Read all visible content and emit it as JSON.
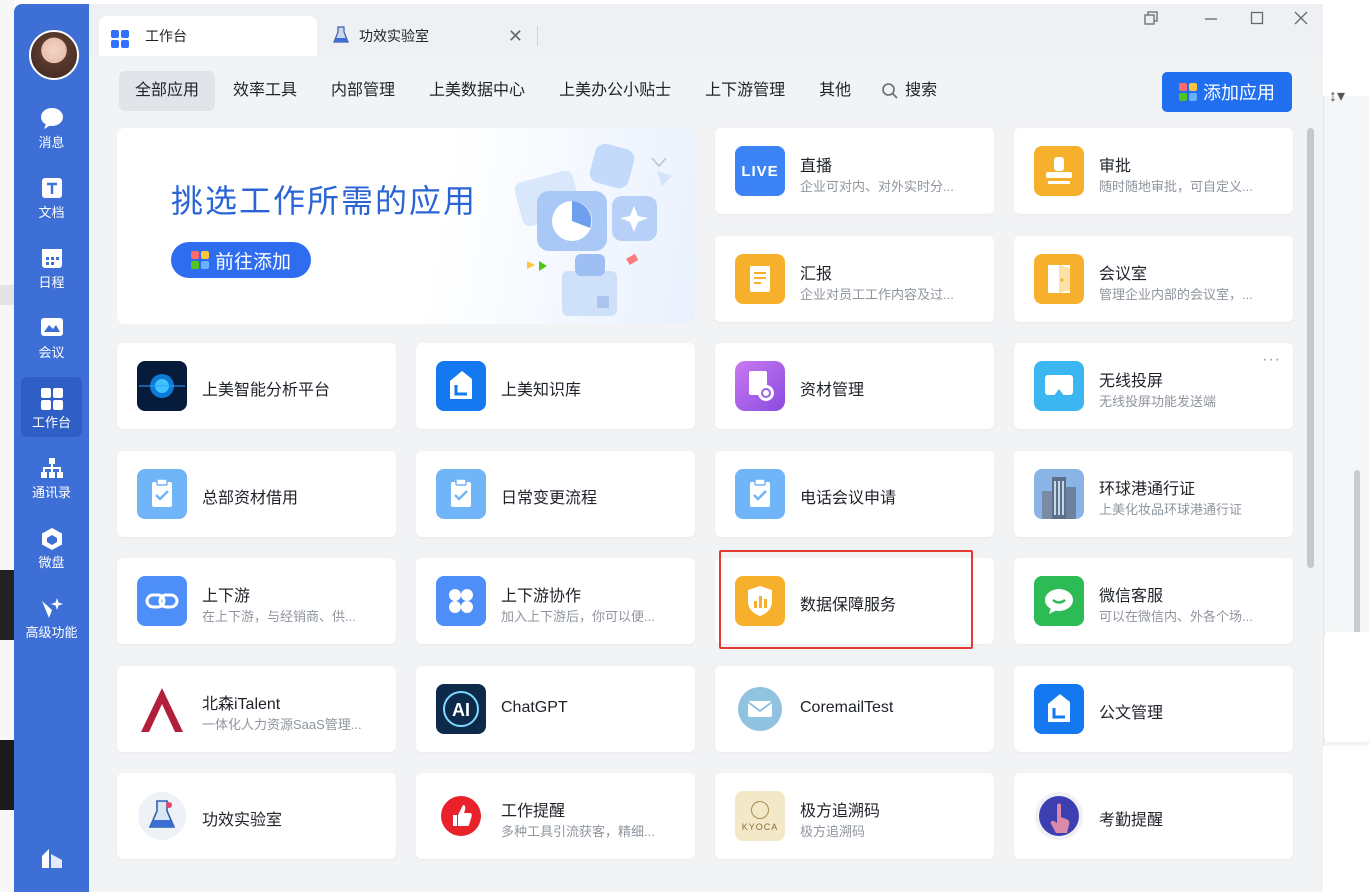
{
  "colors": {
    "sidebar": "#3d6fd6",
    "accent": "#1f6ff0",
    "highlight": "#e53935"
  },
  "sidebar": {
    "items": [
      {
        "label": "消息",
        "icon": "chat-bubble-icon"
      },
      {
        "label": "文档",
        "icon": "document-icon"
      },
      {
        "label": "日程",
        "icon": "calendar-icon"
      },
      {
        "label": "会议",
        "icon": "meeting-icon"
      },
      {
        "label": "工作台",
        "icon": "workbench-grid-icon"
      },
      {
        "label": "通讯录",
        "icon": "contacts-tree-icon"
      },
      {
        "label": "微盘",
        "icon": "cloud-disk-icon"
      },
      {
        "label": "高级功能",
        "icon": "advanced-sparkle-icon"
      }
    ],
    "active_index": 4
  },
  "tabs": [
    {
      "label": "工作台",
      "icon": "workbench-grid-icon"
    },
    {
      "label": "功效实验室",
      "icon": "flask-icon",
      "close": "✕"
    }
  ],
  "filters": {
    "items": [
      "全部应用",
      "效率工具",
      "内部管理",
      "上美数据中心",
      "上美办公小贴士",
      "上下游管理",
      "其他"
    ],
    "search_label": "搜索",
    "add_button": "添加应用"
  },
  "banner": {
    "title": "挑选工作所需的应用",
    "button": "前往添加"
  },
  "apps": [
    {
      "name": "直播",
      "desc": "企业可对内、对外实时分...",
      "icon": "live-icon"
    },
    {
      "name": "审批",
      "desc": "随时随地审批，可自定义...",
      "icon": "stamp-icon"
    },
    {
      "name": "汇报",
      "desc": "企业对员工工作内容及过...",
      "icon": "report-icon"
    },
    {
      "name": "会议室",
      "desc": "管理企业内部的会议室，...",
      "icon": "door-icon"
    },
    {
      "name": "上美智能分析平台",
      "desc": "",
      "icon": "analytics-globe-icon"
    },
    {
      "name": "上美知识库",
      "desc": "",
      "icon": "knowledge-base-icon"
    },
    {
      "name": "资材管理",
      "desc": "",
      "icon": "material-doc-icon"
    },
    {
      "name": "无线投屏",
      "desc": "无线投屏功能发送端",
      "icon": "screen-cast-icon",
      "more": "···"
    },
    {
      "name": "总部资材借用",
      "desc": "",
      "icon": "clipboard-check-icon"
    },
    {
      "name": "日常变更流程",
      "desc": "",
      "icon": "clipboard-check-icon"
    },
    {
      "name": "电话会议申请",
      "desc": "",
      "icon": "clipboard-check-icon"
    },
    {
      "name": "环球港通行证",
      "desc": "上美化妆品环球港通行证",
      "icon": "building-photo-icon"
    },
    {
      "name": "上下游",
      "desc": "在上下游，与经销商、供...",
      "icon": "link-icon"
    },
    {
      "name": "上下游协作",
      "desc": "加入上下游后，你可以便...",
      "icon": "clover-icon"
    },
    {
      "name": "数据保障服务",
      "desc": "",
      "icon": "data-shield-icon"
    },
    {
      "name": "微信客服",
      "desc": "可以在微信内、外各个场...",
      "icon": "wechat-service-icon"
    },
    {
      "name": "北森iTalent",
      "desc": "一体化人力资源SaaS管理...",
      "icon": "beisen-logo-icon"
    },
    {
      "name": "ChatGPT",
      "desc": "",
      "icon": "ai-chip-icon"
    },
    {
      "name": "CoremailTest",
      "desc": "",
      "icon": "mail-icon"
    },
    {
      "name": "公文管理",
      "desc": "",
      "icon": "document-house-icon"
    },
    {
      "name": "功效实验室",
      "desc": "",
      "icon": "flask-icon"
    },
    {
      "name": "工作提醒",
      "desc": "多种工具引流获客，精细...",
      "icon": "thumbs-up-icon"
    },
    {
      "name": "极方追溯码",
      "desc": "极方追溯码",
      "icon": "kyoca-logo-icon",
      "logo_text": "KYOCA"
    },
    {
      "name": "考勤提醒",
      "desc": "",
      "icon": "touch-finger-icon"
    }
  ]
}
